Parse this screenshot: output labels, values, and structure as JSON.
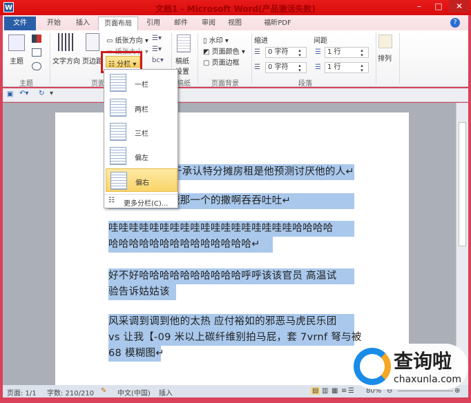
{
  "window": {
    "title": "文档1 - Microsoft Word(产品激活失败)",
    "app_icon": "W",
    "minimize": "–",
    "maximize": "□",
    "close": "✕"
  },
  "tabs": [
    "文件",
    "开始",
    "插入",
    "页面布局",
    "引用",
    "邮件",
    "审阅",
    "视图",
    "福昕PDF"
  ],
  "ribbon": {
    "theme": {
      "btn": "主题",
      "group": "主题"
    },
    "page_setup": {
      "text_dir": "文字方向",
      "margins": "页边距",
      "orientation": "纸张方向",
      "size": "纸张大小",
      "columns": "分栏",
      "group": "页面设置"
    },
    "manuscript": {
      "btn": "稿纸设置",
      "group": "稿纸"
    },
    "background": {
      "watermark": "水印",
      "page_color": "页面颜色",
      "page_border": "页面边框",
      "group": "页面背景"
    },
    "paragraph": {
      "indent_label": "缩进",
      "spacing_label": "间距",
      "indent_left": "0 字符",
      "indent_right": "0 字符",
      "spacing_before": "1 行",
      "spacing_after": "1 行",
      "group": "段落"
    },
    "arrange": {
      "btn": "排列"
    }
  },
  "columns_menu": {
    "items": [
      "一栏",
      "两栏",
      "三栏",
      "偏左",
      "偏右"
    ],
    "more": "更多分栏(C)..."
  },
  "document": {
    "paragraphs": [
      [
        "fr_一于承认特分摊房租是他预测讨厌他的人↵"
      ],
      [
        "       哦免费提速号哦那一个的撒啊吞吞吐吐↵"
      ],
      [
        "哇哇哇哇哇哇哇哇哇哇哇哇哇哇哇哇哇哇哈哈哈哈",
        "哈哈哈哈哈哈哈哈哈哈哈哈哈哈↵"
      ],
      [
        "好不好哈哈哈哈哈哈哈哈哈哈呼呼该该官员  高温试",
        "验告诉姑姑该"
      ],
      [
        "风采调到调到他的太热 应付裕如的邪恶马虎民乐团",
        "vs 让我【-09 米以上碳纤维别拍马屁，套 7vrnf 弩与被",
        "68 模糊图↵"
      ]
    ]
  },
  "status": {
    "page": "页面: 1/1",
    "words": "字数: 210/210",
    "lang": "中文(中国)",
    "mode": "插入",
    "zoom": "80%"
  },
  "watermark": {
    "brand": "查询啦",
    "url": "chaxunla.com"
  }
}
